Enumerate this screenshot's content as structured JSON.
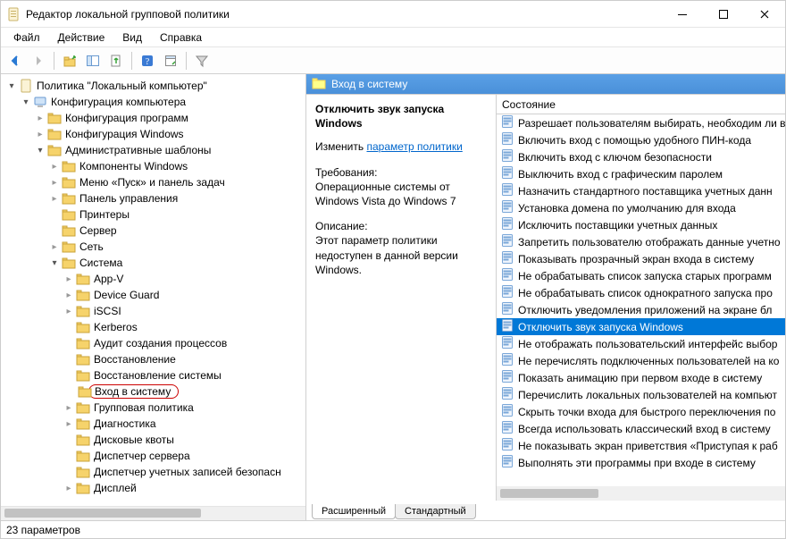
{
  "window": {
    "title": "Редактор локальной групповой политики"
  },
  "menu": {
    "file": "Файл",
    "action": "Действие",
    "view": "Вид",
    "help": "Справка"
  },
  "tree": {
    "root": "Политика \"Локальный компьютер\"",
    "computer_config": "Конфигурация компьютера",
    "software_config": "Конфигурация программ",
    "windows_config": "Конфигурация Windows",
    "admin_templates": "Административные шаблоны",
    "components_windows": "Компоненты Windows",
    "start_menu": "Меню «Пуск» и панель задач",
    "control_panel": "Панель управления",
    "printers": "Принтеры",
    "server": "Сервер",
    "network": "Сеть",
    "system": "Система",
    "appv": "App-V",
    "device_guard": "Device Guard",
    "iscsi": "iSCSI",
    "kerberos": "Kerberos",
    "audit": "Аудит создания процессов",
    "restore": "Восстановление",
    "system_restore": "Восстановление системы",
    "logon": "Вход в систему",
    "group_policy": "Групповая политика",
    "diagnostics": "Диагностика",
    "disk_quotas": "Дисковые квоты",
    "server_manager": "Диспетчер сервера",
    "sec_accounts_mgr": "Диспетчер учетных записей безопасн",
    "display": "Дисплей"
  },
  "header": {
    "path": "Вход в систему"
  },
  "desc": {
    "title": "Отключить звук запуска Windows",
    "edit_label": "Изменить",
    "edit_link": "параметр политики",
    "req_label": "Требования:",
    "req_text": "Операционные системы от Windows Vista до Windows 7",
    "desc_label": "Описание:",
    "desc_text": "Этот параметр политики недоступен в данной версии Windows."
  },
  "list": {
    "column": "Состояние",
    "items": [
      "Разрешает пользователям выбирать, необходим ли в",
      "Включить вход с помощью удобного ПИН-кода",
      "Включить вход с ключом безопасности",
      "Выключить вход с графическим паролем",
      "Назначить стандартного поставщика учетных данн",
      "Установка домена по умолчанию для входа",
      "Исключить поставщики учетных данных",
      "Запретить пользователю отображать данные учетно",
      "Показывать прозрачный экран входа в систему",
      "Не обрабатывать список запуска старых программ",
      "Не обрабатывать список однократного запуска про",
      "Отключить уведомления приложений на экране бл",
      "Отключить звук запуска Windows",
      "Не отображать пользовательский интерфейс выбор",
      "Не перечислять подключенных пользователей на ко",
      "Показать анимацию при первом входе в систему",
      "Перечислить локальных пользователей на компьют",
      "Скрыть точки входа для быстрого переключения по",
      "Всегда использовать классический вход в систему",
      "Не показывать экран приветствия «Приступая к раб",
      "Выполнять эти программы при входе в систему"
    ],
    "selected_index": 12
  },
  "tabs": {
    "extended": "Расширенный",
    "standard": "Стандартный"
  },
  "status": {
    "text": "23 параметров"
  }
}
